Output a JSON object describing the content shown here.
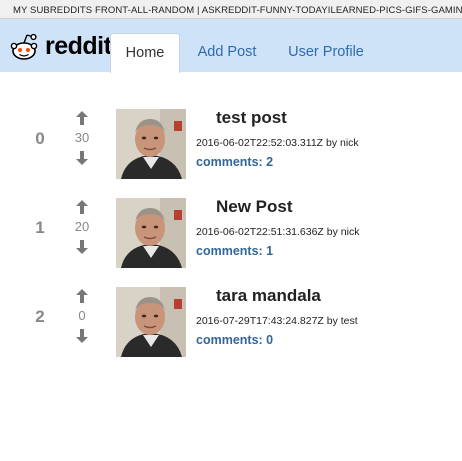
{
  "top_bar": {
    "text": "MY SUBREDDITS FRONT-ALL-RANDOM | ASKREDDIT-FUNNY-TODAYILEARNED-PICS-GIFS-GAMING"
  },
  "header": {
    "logo_text": "reddit",
    "tabs": [
      {
        "label": "Home"
      },
      {
        "label": "Add Post"
      },
      {
        "label": "User Profile"
      }
    ]
  },
  "posts": [
    {
      "rank": "0",
      "score": "30",
      "title": "test post",
      "meta": "2016-06-02T22:52:03.311Z by nick",
      "comments": "comments: 2"
    },
    {
      "rank": "1",
      "score": "20",
      "title": "New Post",
      "meta": "2016-06-02T22:51:31.636Z by nick",
      "comments": "comments: 1"
    },
    {
      "rank": "2",
      "score": "0",
      "title": "tara mandala",
      "meta": "2016-07-29T17:43:24.827Z by test",
      "comments": "comments: 0"
    }
  ],
  "icons": {
    "upvote": "arrow-up-icon",
    "downvote": "arrow-down-icon",
    "thumbnail": "portrait-thumbnail"
  },
  "colors": {
    "header_bg": "#cee3f8",
    "link": "#2f6bb0",
    "comments_link": "#336699",
    "rank_score": "#888888"
  }
}
